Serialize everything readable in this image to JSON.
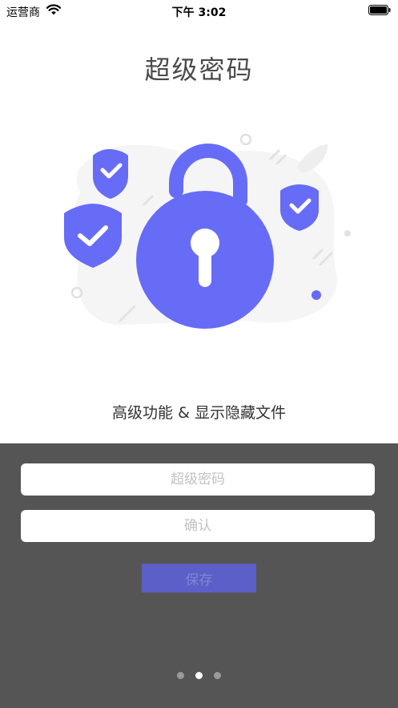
{
  "status_bar": {
    "carrier": "运营商",
    "time": "下午 3:02"
  },
  "page": {
    "title": "超级密码",
    "feature_caption": "高级功能 & 显示隐藏文件"
  },
  "form": {
    "password_placeholder": "超级密码",
    "confirm_placeholder": "确认",
    "save_label": "保存"
  },
  "pager": {
    "total": 3,
    "active_index": 1
  },
  "colors": {
    "accent": "#676cf6",
    "panel_bg": "#555555",
    "save_button_bg": "#5b5fc7",
    "field_bg": "#ffffff"
  },
  "icons": [
    "wifi-icon",
    "battery-icon",
    "padlock-open-icon",
    "shield-check-icon"
  ]
}
